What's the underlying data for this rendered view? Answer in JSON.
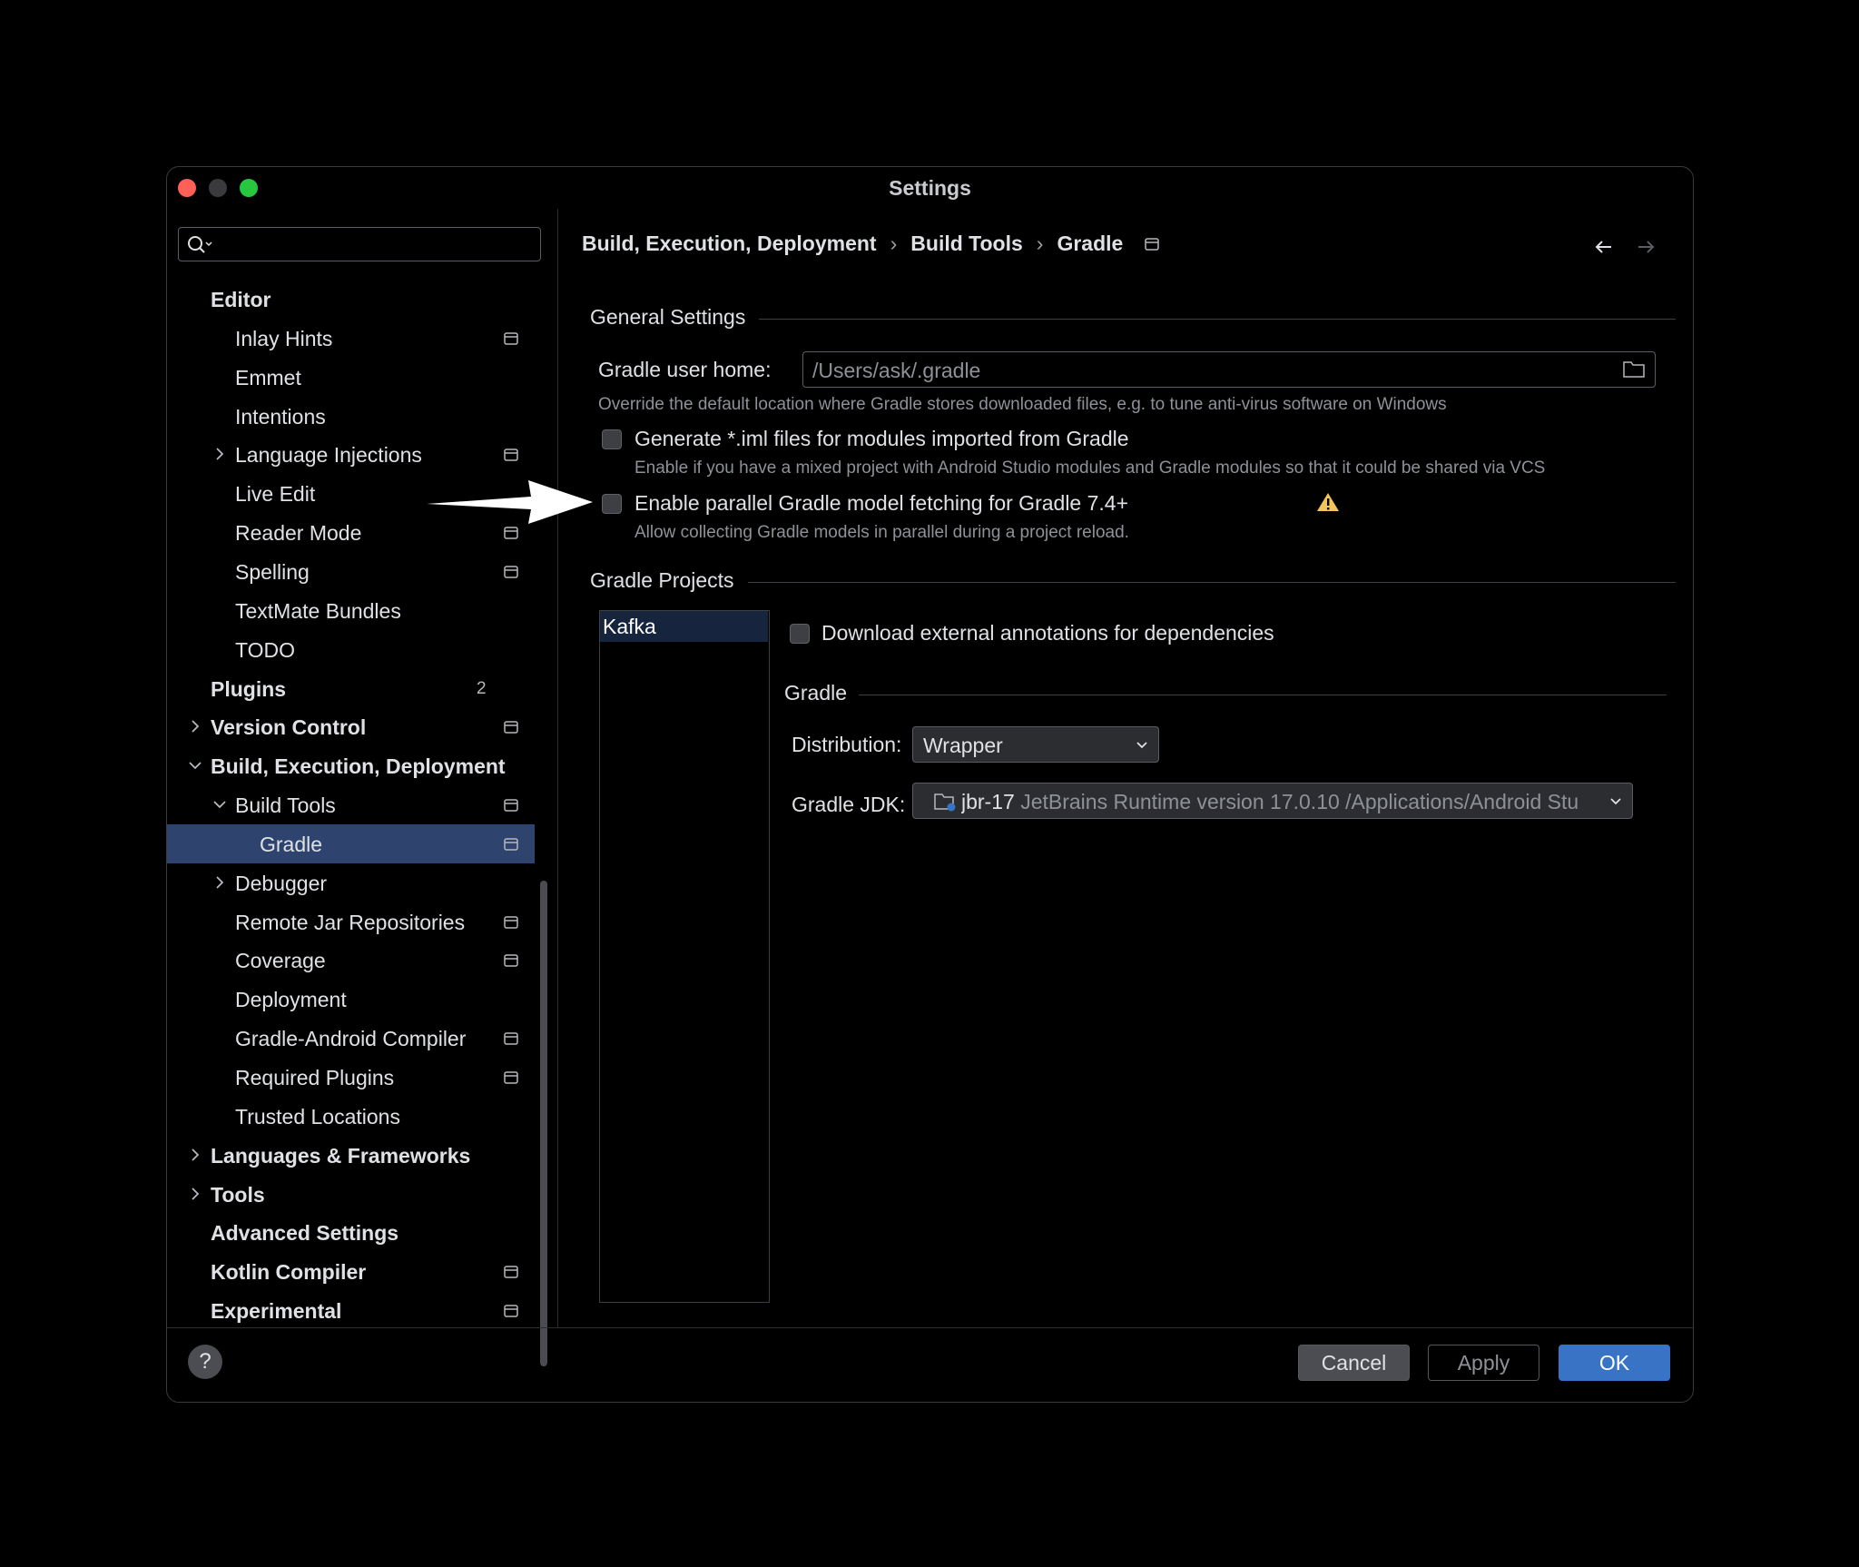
{
  "window": {
    "title": "Settings"
  },
  "search": {
    "placeholder": ""
  },
  "sidebar": {
    "items": [
      {
        "label": "Editor",
        "bold": true,
        "level": 0,
        "chevron": "none",
        "icon": ""
      },
      {
        "label": "Inlay Hints",
        "bold": false,
        "level": 1,
        "chevron": "none",
        "icon": "project-settings-icon"
      },
      {
        "label": "Emmet",
        "bold": false,
        "level": 1,
        "chevron": "none",
        "icon": ""
      },
      {
        "label": "Intentions",
        "bold": false,
        "level": 1,
        "chevron": "none",
        "icon": ""
      },
      {
        "label": "Language Injections",
        "bold": false,
        "level": 1,
        "chevron": "right",
        "icon": "project-settings-icon"
      },
      {
        "label": "Live Edit",
        "bold": false,
        "level": 1,
        "chevron": "none",
        "icon": ""
      },
      {
        "label": "Reader Mode",
        "bold": false,
        "level": 1,
        "chevron": "none",
        "icon": "project-settings-icon"
      },
      {
        "label": "Spelling",
        "bold": false,
        "level": 1,
        "chevron": "none",
        "icon": "project-settings-icon"
      },
      {
        "label": "TextMate Bundles",
        "bold": false,
        "level": 1,
        "chevron": "none",
        "icon": ""
      },
      {
        "label": "TODO",
        "bold": false,
        "level": 1,
        "chevron": "none",
        "icon": ""
      },
      {
        "label": "Plugins",
        "bold": true,
        "level": 0,
        "chevron": "none",
        "icon": "",
        "count": "2"
      },
      {
        "label": "Version Control",
        "bold": true,
        "level": 0,
        "chevron": "right",
        "icon": "project-settings-icon"
      },
      {
        "label": "Build, Execution, Deployment",
        "bold": true,
        "level": 0,
        "chevron": "down",
        "icon": ""
      },
      {
        "label": "Build Tools",
        "bold": false,
        "level": 1,
        "chevron": "down",
        "icon": "project-settings-icon"
      },
      {
        "label": "Gradle",
        "bold": false,
        "level": 2,
        "chevron": "none",
        "icon": "project-settings-icon",
        "selected": true
      },
      {
        "label": "Debugger",
        "bold": false,
        "level": 1,
        "chevron": "right",
        "icon": ""
      },
      {
        "label": "Remote Jar Repositories",
        "bold": false,
        "level": 1,
        "chevron": "none",
        "icon": "project-settings-icon"
      },
      {
        "label": "Coverage",
        "bold": false,
        "level": 1,
        "chevron": "none",
        "icon": "project-settings-icon"
      },
      {
        "label": "Deployment",
        "bold": false,
        "level": 1,
        "chevron": "none",
        "icon": ""
      },
      {
        "label": "Gradle-Android Compiler",
        "bold": false,
        "level": 1,
        "chevron": "none",
        "icon": "project-settings-icon"
      },
      {
        "label": "Required Plugins",
        "bold": false,
        "level": 1,
        "chevron": "none",
        "icon": "project-settings-icon"
      },
      {
        "label": "Trusted Locations",
        "bold": false,
        "level": 1,
        "chevron": "none",
        "icon": ""
      },
      {
        "label": "Languages & Frameworks",
        "bold": true,
        "level": 0,
        "chevron": "right",
        "icon": ""
      },
      {
        "label": "Tools",
        "bold": true,
        "level": 0,
        "chevron": "right",
        "icon": ""
      },
      {
        "label": "Advanced Settings",
        "bold": true,
        "level": 0,
        "chevron": "none",
        "icon": ""
      },
      {
        "label": "Kotlin Compiler",
        "bold": true,
        "level": 0,
        "chevron": "none",
        "icon": "project-settings-icon"
      },
      {
        "label": "Experimental",
        "bold": true,
        "level": 0,
        "chevron": "none",
        "icon": "project-settings-icon"
      }
    ]
  },
  "breadcrumb": {
    "part1": "Build, Execution, Deployment",
    "sep": "›",
    "part2": "Build Tools",
    "part3": "Gradle"
  },
  "general": {
    "title": "General Settings",
    "user_home_label": "Gradle user home:",
    "user_home_value": "/Users/ask/.gradle",
    "user_home_hint": "Override the default location where Gradle stores downloaded files, e.g. to tune anti-virus software on Windows",
    "iml_label": "Generate *.iml files for modules imported from Gradle",
    "iml_hint": "Enable if you have a mixed project with Android Studio modules and Gradle modules so that it could be shared via VCS",
    "iml_checked": false,
    "parallel_label": "Enable parallel Gradle model fetching for Gradle 7.4+",
    "parallel_hint": "Allow collecting Gradle models in parallel during a project reload.",
    "parallel_checked": false
  },
  "projects": {
    "title": "Gradle Projects",
    "list": [
      "Kafka"
    ],
    "download_annotations_label": "Download external annotations for dependencies",
    "download_annotations_checked": false,
    "gradle_title": "Gradle",
    "distribution_label": "Distribution:",
    "distribution_value": "Wrapper",
    "jdk_label": "Gradle JDK:",
    "jdk_name": "jbr-17",
    "jdk_desc": "JetBrains Runtime version 17.0.10 /Applications/Android Stu"
  },
  "buttons": {
    "help": "?",
    "cancel": "Cancel",
    "apply": "Apply",
    "ok": "OK"
  },
  "colors": {
    "accent": "#3873c6",
    "selection": "#2e436e",
    "warning": "#f2c55c"
  }
}
